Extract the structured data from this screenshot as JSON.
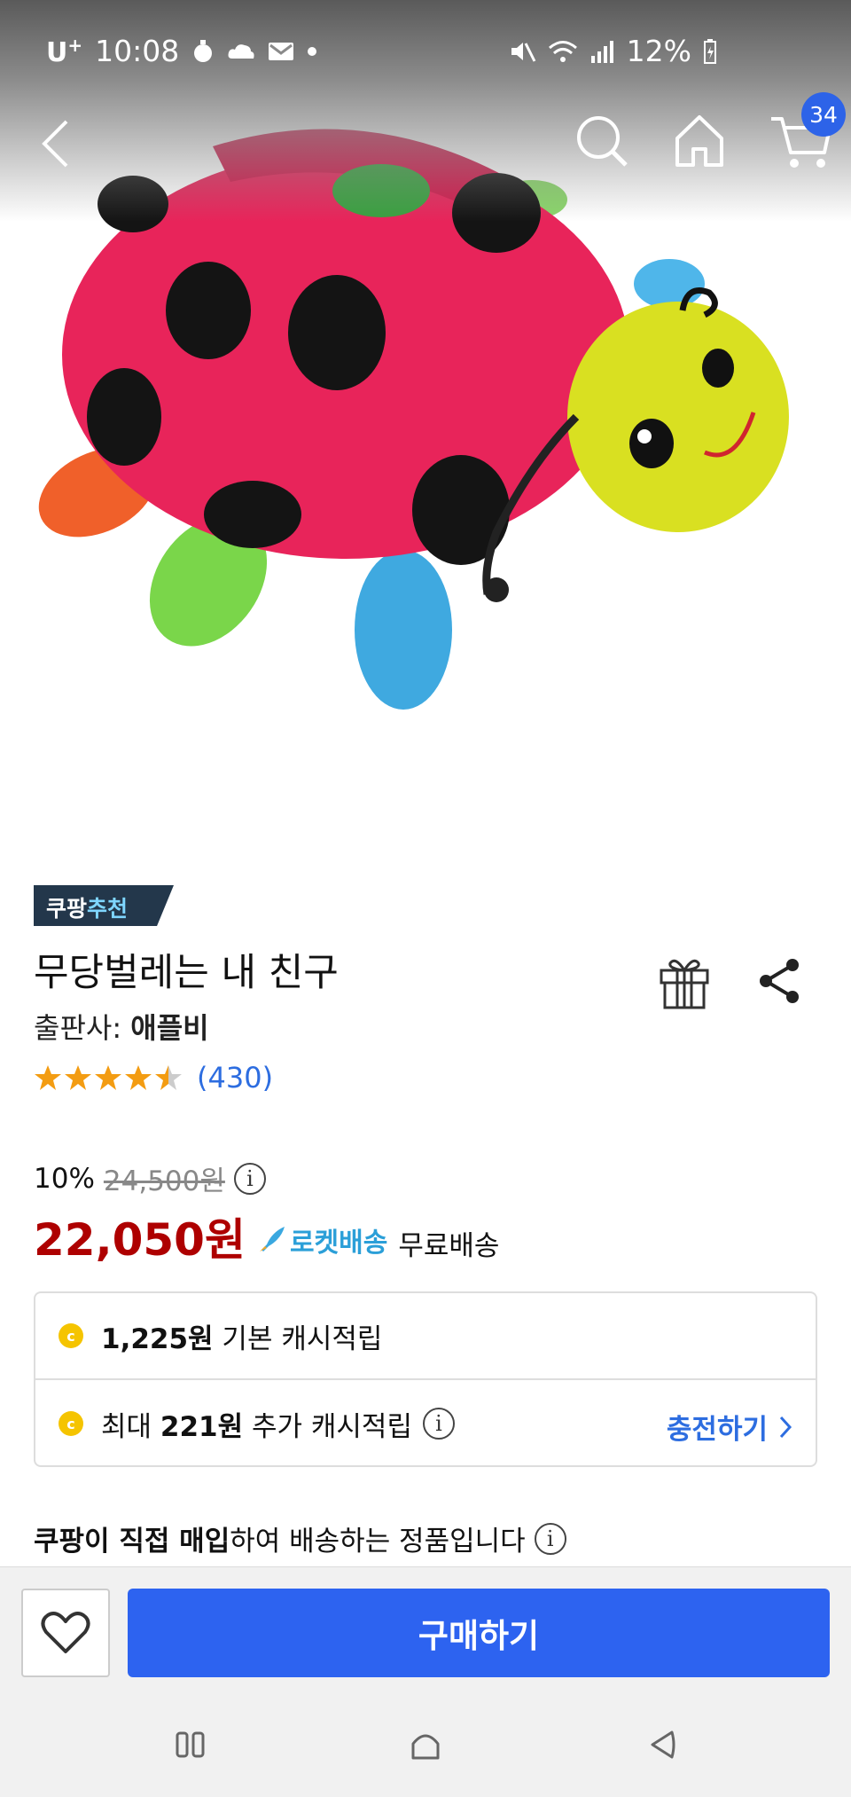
{
  "status_bar": {
    "carrier": "U",
    "carrier_sup": "+",
    "time": "10:08",
    "battery": "12%"
  },
  "nav": {
    "cart_count": "34"
  },
  "product": {
    "badge_prefix": "쿠팡",
    "badge_accent": "추천",
    "title": "무당벌레는 내 친구",
    "publisher_label": "출판사: ",
    "publisher_name": "애플비",
    "rating": 4.5,
    "review_count": "(430)",
    "discount": "10%",
    "original_price": "24,500원",
    "price": "22,050원",
    "rocket_label": "로켓배송",
    "shipping": "무료배송"
  },
  "cash": {
    "row1_amount": "1,225원",
    "row1_text": " 기본 캐시적립",
    "row2_prefix": "최대 ",
    "row2_amount": "221원",
    "row2_text": " 추가 캐시적립",
    "charge_link": "충전하기",
    "coin_symbol": "c"
  },
  "notice": {
    "bold": "쿠팡이 직접 매입",
    "rest": "하여 배송하는 정품입니다"
  },
  "buy_bar": {
    "buy_label": "구매하기"
  },
  "colors": {
    "accent_blue": "#2d63f0",
    "price_red": "#ae0000",
    "rocket_blue": "#2b9fd8",
    "star_orange": "#f39c12"
  }
}
